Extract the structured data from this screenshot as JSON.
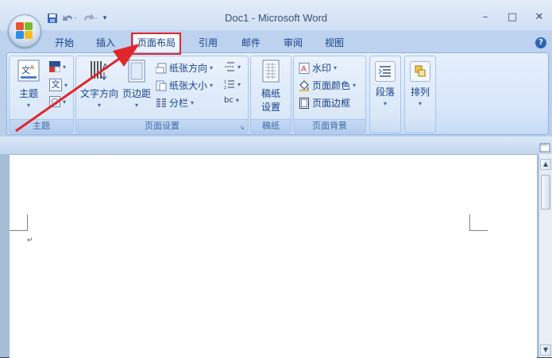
{
  "window": {
    "title": "Doc1 - Microsoft Word",
    "controls": {
      "minimize": "–",
      "maximize": "□",
      "close": "✕"
    }
  },
  "quick_access": {
    "save_icon": "save-icon",
    "undo_icon": "undo-icon",
    "redo_icon": "redo-icon"
  },
  "tabs": [
    {
      "label": "开始",
      "active": false
    },
    {
      "label": "插入",
      "active": false
    },
    {
      "label": "页面布局",
      "active": true
    },
    {
      "label": "引用",
      "active": false
    },
    {
      "label": "邮件",
      "active": false
    },
    {
      "label": "审阅",
      "active": false
    },
    {
      "label": "视图",
      "active": false
    }
  ],
  "help": "?",
  "ribbon": {
    "theme_group": {
      "label": "主题",
      "theme_button": "主题",
      "fonts_glyph": "文"
    },
    "page_setup_group": {
      "label": "页面设置",
      "text_direction": "文字方向",
      "margins": "页边距",
      "orientation": "纸张方向",
      "size": "纸张大小",
      "columns": "分栏",
      "hyphenation": "bc"
    },
    "draft_group": {
      "label": "稿纸",
      "draft_setup_line1": "稿纸",
      "draft_setup_line2": "设置"
    },
    "page_background_group": {
      "label": "页面背景",
      "watermark": "水印",
      "page_color": "页面颜色",
      "page_borders": "页面边框"
    },
    "paragraph_group": {
      "button": "段落"
    },
    "arrange_group": {
      "button": "排列"
    }
  },
  "document": {
    "paragraph_mark": "↵"
  },
  "colors": {
    "annotation_red": "#e0262a",
    "ribbon_blue": "#15428b"
  }
}
